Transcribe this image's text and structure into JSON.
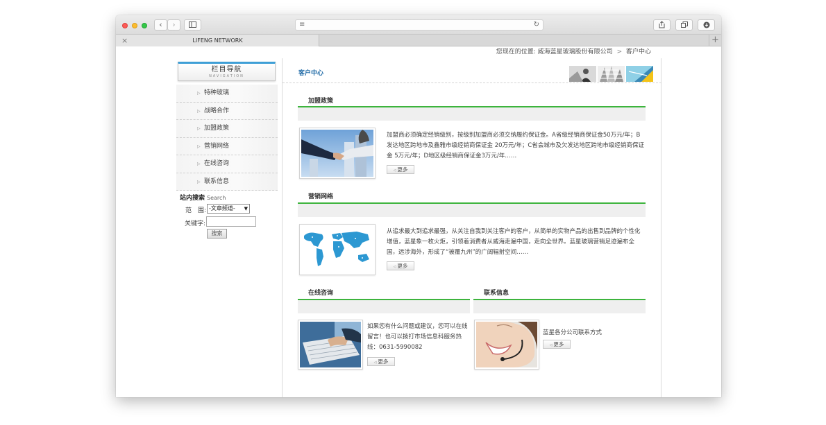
{
  "browser": {
    "tab_title": "LIFENG NETWORK",
    "url": ""
  },
  "breadcrumb": {
    "prefix": "您现在的位置: 威海蓝星玻璃股份有限公司",
    "sep": ">",
    "current": "客户中心"
  },
  "sidebar": {
    "nav_title": "栏目导航",
    "nav_title_en": "NAVIGATION",
    "items": [
      "特种玻璃",
      "战略合作",
      "加盟政策",
      "营销网络",
      "在线咨询",
      "联系信息"
    ],
    "search_title": "站内搜索",
    "search_title_en": "Search",
    "scope_label": "范　围:",
    "scope_value": "-文章频道-",
    "keyword_label": "关键字:",
    "keyword_value": "",
    "search_button": "搜索"
  },
  "content": {
    "title": "客户中心",
    "more_label": "更多",
    "sections": {
      "join": {
        "title": "加盟政策",
        "text": "加盟商必须确定经销级别，按级别加盟商必须交纳履约保证金。A省级经销商保证金50万元/年；B发达地区跨地市及鑫雅市级经销商保证金 20万元/年；C省会城市及欠发达地区跨地市级经销商保证金 5万元/年；D地区级经销商保证金3万元/年……"
      },
      "network": {
        "title": "营销网络",
        "text": "从追求最大到追求最强，从关注自我到关注客户的客户，从简单的实物产品的出售到品牌的个性化增值，蓝星象一枚火炬，引领着消费者从威海走遍中国，走向全世界。蓝星玻璃营销足迹遍布全国，远涉海外，形成了“被覆九州”的广阔辐射空间……"
      },
      "consult": {
        "title": "在线咨询",
        "text": "如果您有什么问题或建议，您可以在线留言！也可以拨打市场信息科服务热线：0631-5990082"
      },
      "contact": {
        "title": "联系信息",
        "text": "蓝星各分公司联系方式"
      }
    }
  },
  "colors": {
    "accent_green": "#3db43d",
    "title_blue": "#1f6aa6",
    "nav_top_blue": "#3f9fd6"
  }
}
